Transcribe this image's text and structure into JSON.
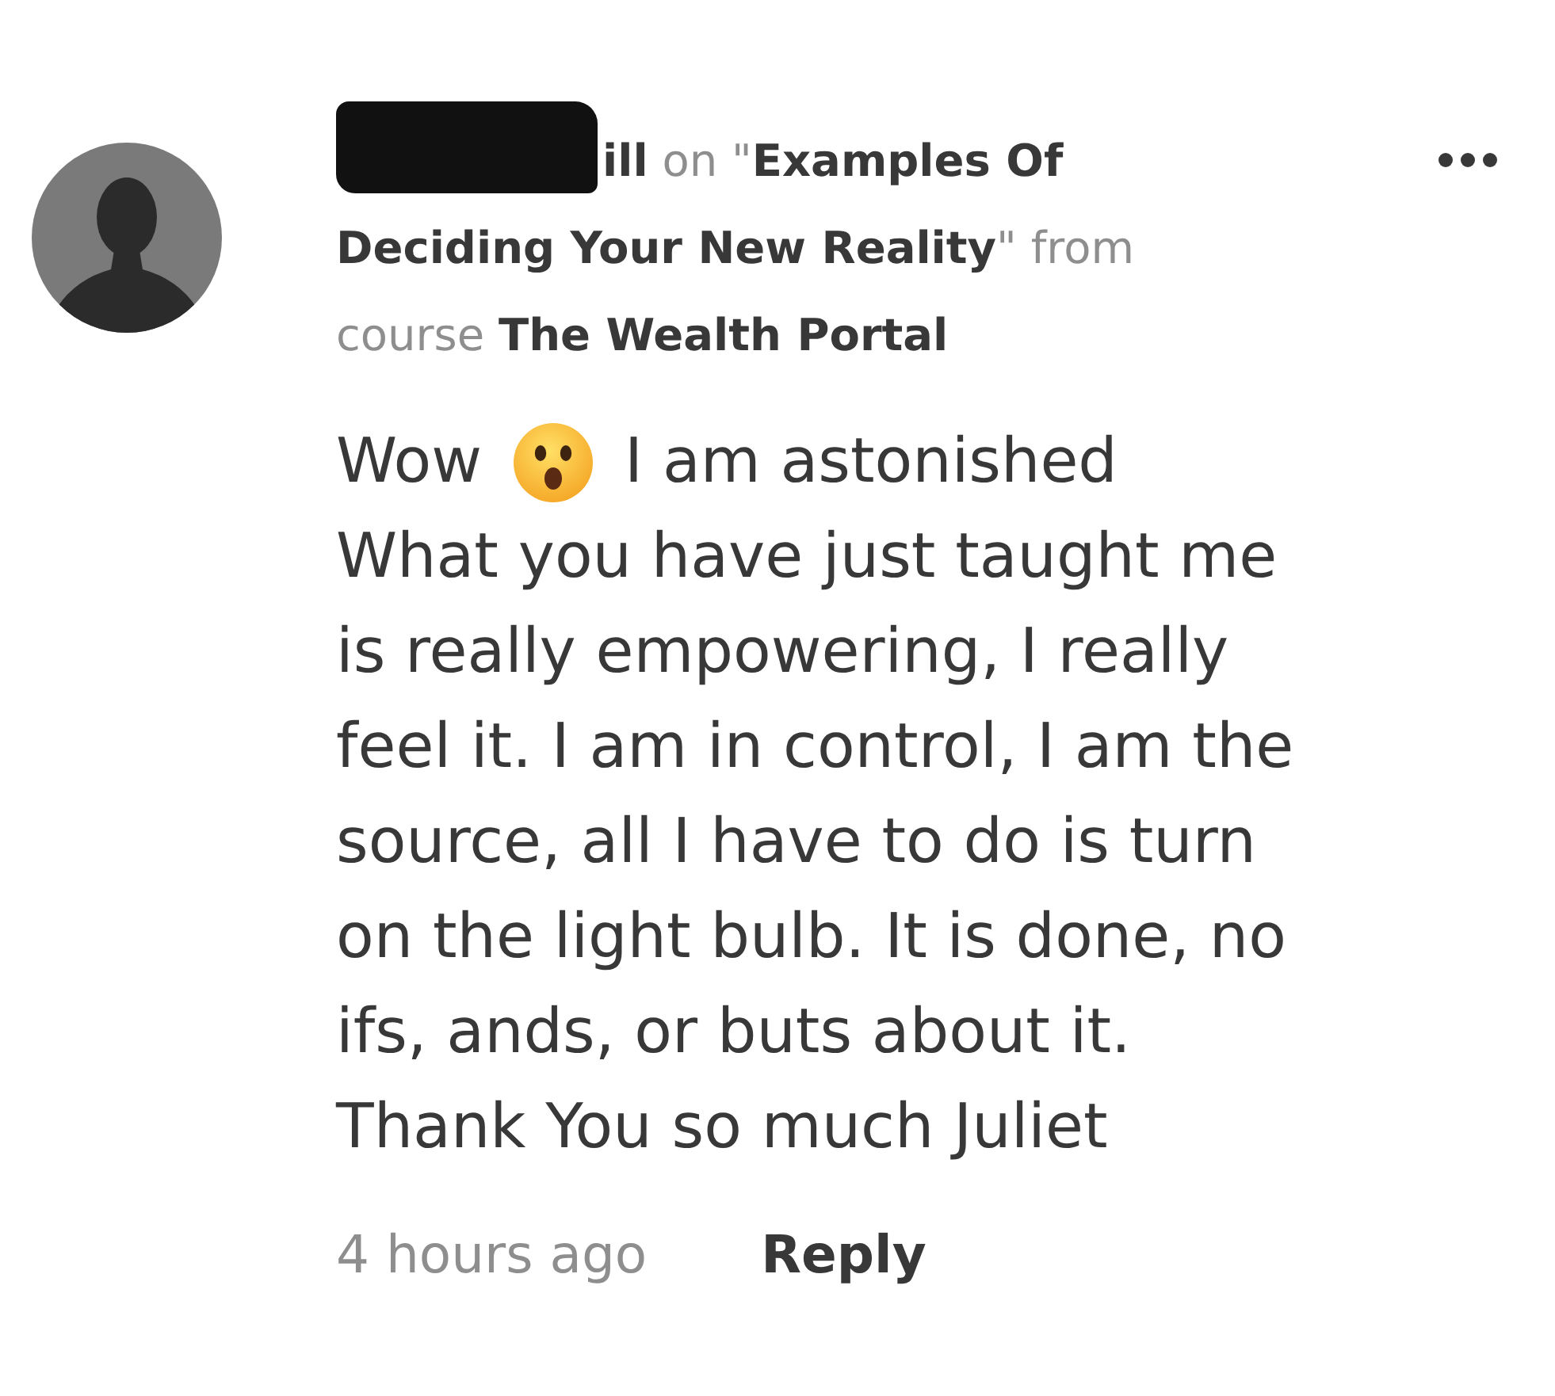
{
  "author": {
    "redacted": true
  },
  "heading_start": "**ill** on \"**Examples Of**",
  "heading_rest": "**Deciding Your New Reality**\" from course **The Wealth Portal**",
  "comment": {
    "lead_before_emoji": "Wow",
    "lead_after_emoji": "I am astonished",
    "body": "What you have just taught me is really empowering, I really feel it. I am in control, I am the source, all I have to do is turn on the light bulb. It is done, no ifs, ands, or buts about it.\nThank You so much Juliet"
  },
  "footer": {
    "time": "4 hours ago",
    "reply": "Reply"
  }
}
